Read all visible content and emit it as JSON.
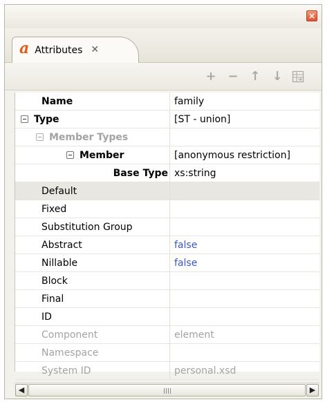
{
  "window": {
    "close_icon": "×"
  },
  "tab": {
    "icon": "a",
    "label": "Attributes",
    "close_icon": "✕"
  },
  "toolbar": {
    "add_icon": "+",
    "remove_icon": "−",
    "up_icon": "↑",
    "down_icon": "↓",
    "export_icon": "table-export-icon"
  },
  "rows": [
    {
      "name": "Name",
      "value": "family"
    },
    {
      "name": "Type",
      "value": "[ST - union]"
    },
    {
      "name": "Member Types",
      "value": ""
    },
    {
      "name": "Member",
      "value": "[anonymous restriction]"
    },
    {
      "name": "Base Type",
      "value": "xs:string"
    },
    {
      "name": "Default",
      "value": ""
    },
    {
      "name": "Fixed",
      "value": ""
    },
    {
      "name": "Substitution Group",
      "value": ""
    },
    {
      "name": "Abstract",
      "value": "false"
    },
    {
      "name": "Nillable",
      "value": "false"
    },
    {
      "name": "Block",
      "value": ""
    },
    {
      "name": "Final",
      "value": ""
    },
    {
      "name": "ID",
      "value": ""
    },
    {
      "name": "Component",
      "value": "element"
    },
    {
      "name": "Namespace",
      "value": ""
    },
    {
      "name": "System ID",
      "value": "personal.xsd"
    }
  ],
  "scrollbar": {
    "left_icon": "◀",
    "right_icon": "▶"
  }
}
